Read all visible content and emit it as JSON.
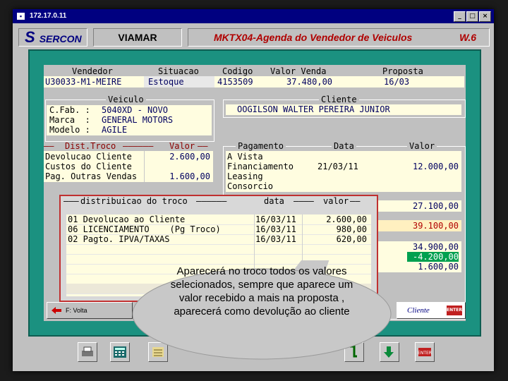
{
  "window": {
    "title": "172.17.0.11"
  },
  "header": {
    "brand": "SERCON",
    "company": "VIAMAR",
    "screen_title": "MKTX04-Agenda do Vendedor de Veiculos",
    "version": "W.6"
  },
  "top_labels": {
    "vendedor": "Vendedor",
    "situacao": "Situacao",
    "codigo": "Codigo",
    "valor_venda": "Valor Venda",
    "proposta": "Proposta"
  },
  "top_values": {
    "vendedor": "U30033-M1-MEIRE",
    "situacao": "Estoque",
    "codigo": "4153509",
    "valor_venda": "37.480,00",
    "proposta": "16/03"
  },
  "veiculo": {
    "title": "Veiculo",
    "rows": [
      {
        "label": "C.Fab. :",
        "value": "5040XD - NOVO"
      },
      {
        "label": "Marca  :",
        "value": "GENERAL MOTORS"
      },
      {
        "label": "Modelo :",
        "value": "AGILE"
      }
    ]
  },
  "cliente": {
    "title": "Cliente",
    "value": "OOGILSON WALTER PEREIRA JUNIOR"
  },
  "troco": {
    "header_left": "Dist.Troco",
    "header_right": "Valor",
    "rows": [
      {
        "label": "Devolucao Cliente",
        "value": "2.600,00"
      },
      {
        "label": "Custos do Cliente",
        "value": ""
      },
      {
        "label": "Pag. Outras Vendas",
        "value": "1.600,00"
      }
    ]
  },
  "pagamento": {
    "headers": {
      "pagamento": "Pagamento",
      "data": "Data",
      "valor": "Valor"
    },
    "rows": [
      {
        "label": "A Vista",
        "data": "",
        "valor": ""
      },
      {
        "label": "Financiamento",
        "data": "21/03/11",
        "valor": "12.000,00"
      },
      {
        "label": "Leasing",
        "data": "",
        "valor": ""
      },
      {
        "label": "Consorcio",
        "data": "",
        "valor": ""
      }
    ],
    "totals": [
      "27.100,00",
      "39.100,00",
      "34.900,00",
      "-4.200,00",
      "1.600,00"
    ]
  },
  "distribuicao": {
    "title": "distribuicao do troco",
    "headers": {
      "data": "data",
      "valor": "valor"
    },
    "rows": [
      {
        "desc": "01 Devolucao ao Cliente",
        "data": "16/03/11",
        "valor": "2.600,00"
      },
      {
        "desc": "06 LICENCIAMENTO    (Pg Troco)",
        "data": "16/03/11",
        "valor": "980,00"
      },
      {
        "desc": "02 Pagto. IPVA/TAXAS",
        "data": "16/03/11",
        "valor": "620,00"
      }
    ]
  },
  "buttons": {
    "volta": "F: Volta",
    "cliente": "Cliente",
    "enter": "ENTER"
  },
  "callout": {
    "text": "Aparecerá no troco todos os valores selecionados,  sempre que aparece um valor recebido a mais na proposta , aparecerá como devolução ao cliente"
  }
}
